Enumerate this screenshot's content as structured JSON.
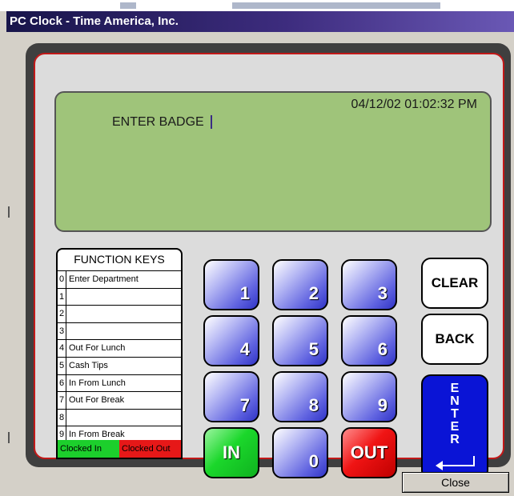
{
  "window": {
    "title": "PC Clock - Time America, Inc."
  },
  "display": {
    "datetime": "04/12/02 01:02:32 PM",
    "prompt": "ENTER BADGE"
  },
  "function_keys": {
    "header": "FUNCTION KEYS",
    "rows": [
      {
        "num": "0",
        "label": "Enter Department"
      },
      {
        "num": "1",
        "label": ""
      },
      {
        "num": "2",
        "label": ""
      },
      {
        "num": "3",
        "label": ""
      },
      {
        "num": "4",
        "label": "Out For Lunch"
      },
      {
        "num": "5",
        "label": "Cash Tips"
      },
      {
        "num": "6",
        "label": "In From Lunch"
      },
      {
        "num": "7",
        "label": "Out For Break"
      },
      {
        "num": "8",
        "label": ""
      },
      {
        "num": "9",
        "label": "In From Break"
      }
    ],
    "status": {
      "clocked_in": "Clocked In",
      "clocked_out": "Clocked Out"
    }
  },
  "keypad": {
    "k1": "1",
    "k2": "2",
    "k3": "3",
    "k4": "4",
    "k5": "5",
    "k6": "6",
    "k7": "7",
    "k8": "8",
    "k9": "9",
    "k0": "0",
    "in": "IN",
    "out": "OUT"
  },
  "side_keys": {
    "clear": "CLEAR",
    "back": "BACK",
    "enter": "ENTER"
  },
  "footer": {
    "close": "Close"
  },
  "colors": {
    "lcd": "#9fc47a",
    "panel_border": "#c21818",
    "in_key": "#1bd72b",
    "out_key": "#f01414",
    "enter_key": "#0a14d6",
    "titlebar": "#18154a"
  }
}
